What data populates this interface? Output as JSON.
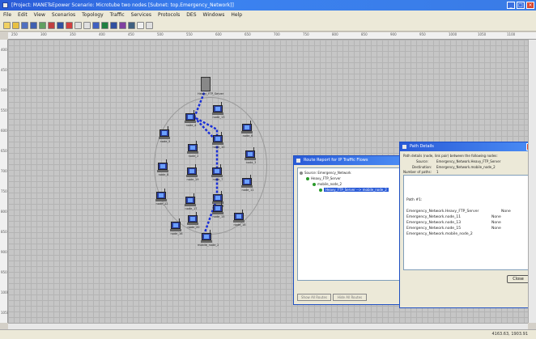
{
  "window": {
    "title": "[Project: MANETsEpower Scenario: Microtube two nodes  [Subnet: top.Emergency_Network]]",
    "minimize": "_",
    "maximize": "□",
    "close": "×"
  },
  "menu": [
    "File",
    "Edit",
    "View",
    "Scenarios",
    "Topology",
    "Traffic",
    "Services",
    "Protocols",
    "DES",
    "Windows",
    "Help"
  ],
  "ruler": {
    "top": [
      "250",
      "300",
      "350",
      "400",
      "450",
      "500",
      "550",
      "600",
      "650",
      "700",
      "750",
      "800",
      "850",
      "900",
      "950",
      "1000",
      "1050",
      "1100"
    ],
    "left": [
      "400",
      "450",
      "500",
      "550",
      "600",
      "650",
      "700",
      "750",
      "800",
      "850",
      "900",
      "950",
      "1000",
      "1050"
    ]
  },
  "nodes": {
    "server": "Heavy_FTP_Server",
    "n4": "node_4",
    "n13": "node_13",
    "n6": "node_6",
    "n5": "node_5",
    "n10": "node_10",
    "n2": "node_2",
    "n3": "node_3",
    "n8": "node_8",
    "n19": "node_19",
    "n7": "node_7",
    "n11": "node_11",
    "n12": "node_12",
    "n17": "node_17",
    "n9": "node_9",
    "n15": "node_15",
    "n20": "node_20",
    "n18": "node_18",
    "n16": "node_16",
    "n1": "node_1",
    "mobile2": "mobile_node_2"
  },
  "route_report": {
    "title": "Route Report for IP Traffic Flows",
    "tree": [
      "Source: Emergency_Network",
      "Heavy_FTP_Server",
      "mobile_node_2",
      "Heavy_FTP_Server --> mobile_node_2"
    ],
    "show_all_routes": "Show All Routes",
    "hide_all_routes": "Hide All Routes"
  },
  "path_details": {
    "title": "Path Details",
    "intro": "Path details (node, link pair) between the following nodes:",
    "source_label": "Source:",
    "source_value": "Emergency_Network.Heavy_FTP_Server",
    "dest_label": "Destination:",
    "dest_value": "Emergency_Network.mobile_node_2",
    "num_paths_label": "Number of paths:",
    "num_paths_value": "1",
    "path_heading": "Path #1:",
    "rows": [
      {
        "node": "Emergency_Network.Heavy_FTP_Server",
        "link": "None"
      },
      {
        "node": "Emergency_Network.node_11",
        "link": "None"
      },
      {
        "node": "Emergency_Network.node_13",
        "link": "None"
      },
      {
        "node": "Emergency_Network.node_15",
        "link": "None"
      },
      {
        "node": "Emergency_Network.mobile_node_2",
        "link": ""
      }
    ],
    "close": "Close"
  },
  "status": {
    "coords": "4163.63, 1903.91"
  }
}
